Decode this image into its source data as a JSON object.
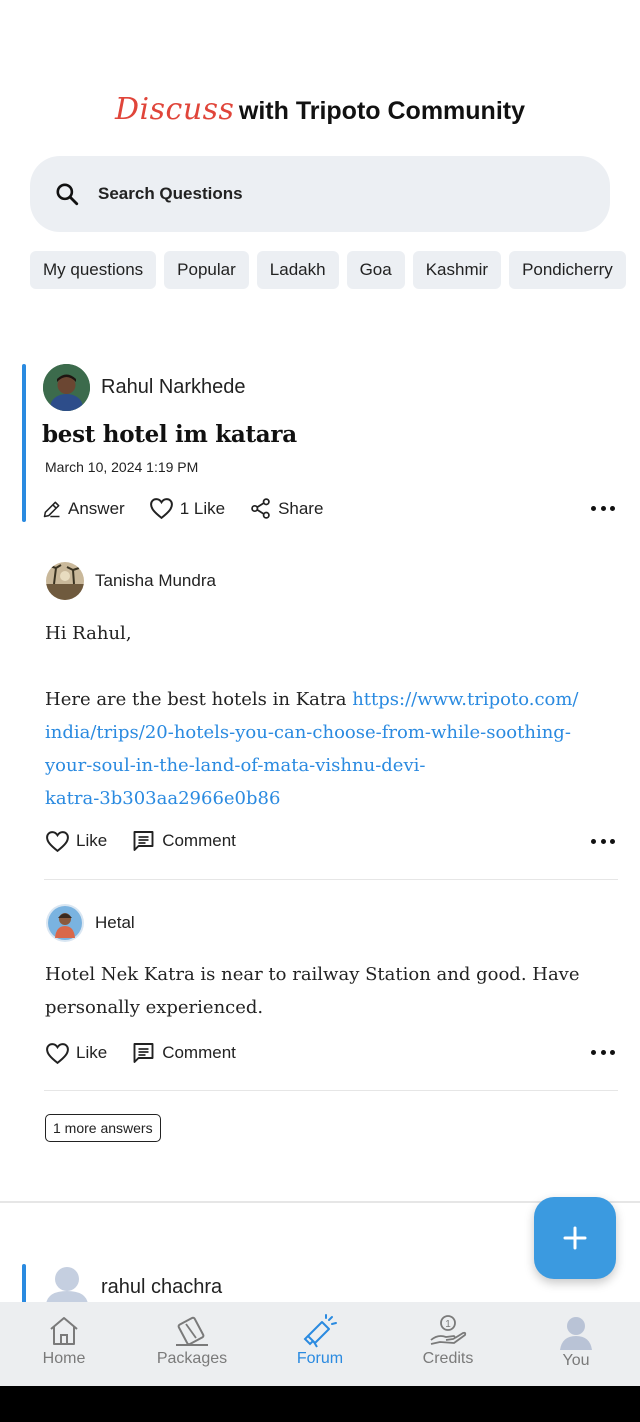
{
  "header": {
    "discuss": "Discuss",
    "title_rest": "with Tripoto Community"
  },
  "search": {
    "label": "Search Questions",
    "icon": "search-icon"
  },
  "chips": [
    "My questions",
    "Popular",
    "Ladakh",
    "Goa",
    "Kashmir",
    "Pondicherry"
  ],
  "question": {
    "author": "Rahul Narkhede",
    "title": "best hotel im katara",
    "date": "March 10, 2024 1:19 PM",
    "actions": {
      "answer": "Answer",
      "like": "1 Like",
      "share": "Share"
    }
  },
  "answers": [
    {
      "author": "Tanisha Mundra",
      "greeting": "Hi Rahul,",
      "body_prefix": "Here are the best hotels in Katra ",
      "link": "https://www.tripoto.com/india/trips/20-hotels-you-can-choose-from-while-soothing-your-soul-in-the-land-of-mata-vishnu-devi-katra-3b303aa2966e0b86",
      "link_lines": [
        "https://www.tripoto.com/",
        "india/trips/20-hotels-you-can-choose-from-while-soothing-",
        "your-soul-in-the-land-of-mata-vishnu-devi-",
        "katra-3b303aa2966e0b86"
      ],
      "like": "Like",
      "comment": "Comment"
    },
    {
      "author": "Hetal",
      "body": "Hotel Nek Katra is near to railway Station and good. Have personally experienced.",
      "like": "Like",
      "comment": "Comment"
    }
  ],
  "more_answers": "1 more answers",
  "next_question": {
    "author": "rahul chachra"
  },
  "nav": [
    {
      "label": "Home",
      "icon": "home-icon"
    },
    {
      "label": "Packages",
      "icon": "packages-icon"
    },
    {
      "label": "Forum",
      "icon": "forum-megaphone-icon",
      "active": true
    },
    {
      "label": "Credits",
      "icon": "credits-icon"
    },
    {
      "label": "You",
      "icon": "user-icon"
    }
  ],
  "colors": {
    "accent": "#2a8ae0",
    "discuss_red": "#e0453a",
    "fab": "#3b9ae0"
  }
}
